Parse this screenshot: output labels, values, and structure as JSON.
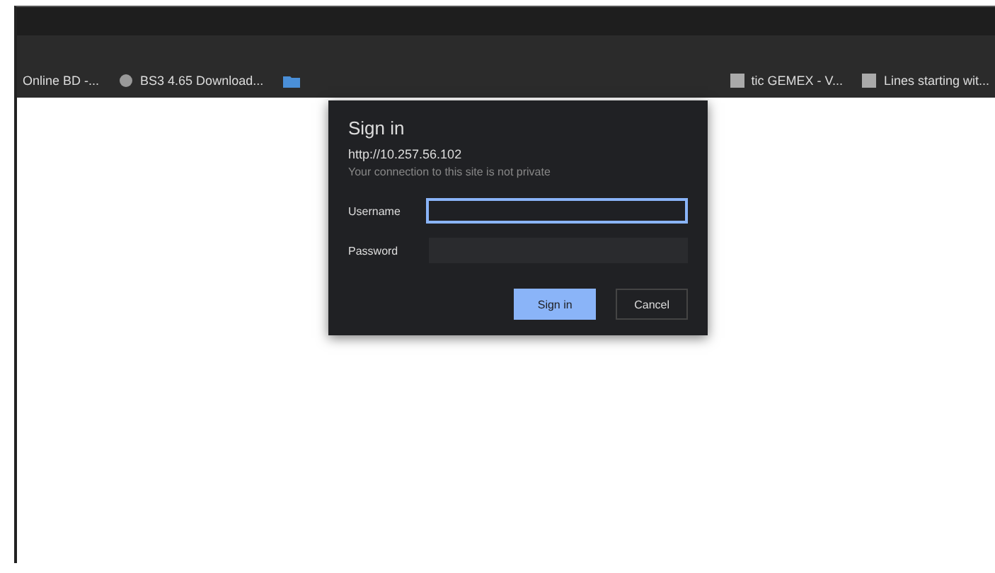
{
  "bookmarks": [
    {
      "label": "Online BD -..."
    },
    {
      "label": "BS3 4.65 Download..."
    },
    {
      "label": "tic GEMEX - V..."
    },
    {
      "label": "Lines starting wit..."
    }
  ],
  "dialog": {
    "title": "Sign in",
    "url": "http://10.257.56.102",
    "warning": "Your connection to this site is not private",
    "fields": [
      {
        "label": "Username",
        "focused": true
      },
      {
        "label": "Password",
        "focused": false
      }
    ],
    "buttons": [
      {
        "label": "Sign in",
        "primary": true
      },
      {
        "label": "Cancel",
        "primary": false
      }
    ]
  }
}
